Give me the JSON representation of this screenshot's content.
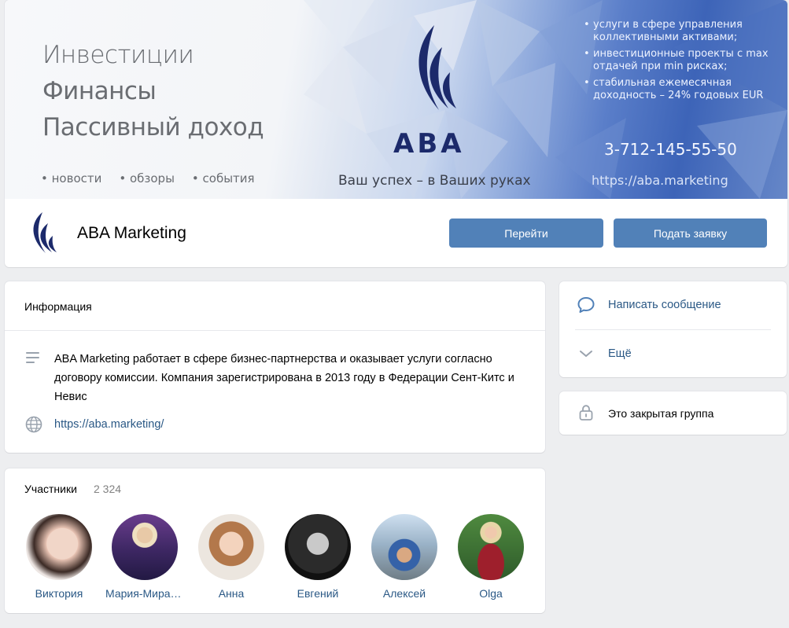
{
  "cover": {
    "line1": "Инвестиции",
    "line2": "Финансы",
    "line3": "Пассивный доход",
    "nav": [
      "• новости",
      "• обзоры",
      "• события"
    ],
    "brand": "ABA",
    "slogan": "Ваш успех – в Ваших руках",
    "bullets": [
      "услуги в сфере управления коллективными активами;",
      "инвестиционные проекты с max отдачей при min рисках;",
      "стабильная ежемесячная доходность – 24% годовых EUR"
    ],
    "phone": "3-712-145-55-50",
    "url": "https://aba.marketing"
  },
  "group": {
    "name": "ABA Marketing",
    "go_label": "Перейти",
    "apply_label": "Подать заявку"
  },
  "info": {
    "title": "Информация",
    "description": "ABA Marketing работает в сфере бизнес-партнерства и оказывает услуги согласно договору комиссии. Компания зарегистрирована в 2013 году в Федерации Сент-Китс и Невис",
    "link": "https://aba.marketing/"
  },
  "members": {
    "title": "Участники",
    "count": "2 324",
    "list": [
      {
        "name": "Виктория"
      },
      {
        "name": "Мария-Мирагуль"
      },
      {
        "name": "Анна"
      },
      {
        "name": "Евгений"
      },
      {
        "name": "Алексей"
      },
      {
        "name": "Olga"
      }
    ]
  },
  "actions": {
    "write_message": "Написать сообщение",
    "more": "Ещё",
    "closed_group": "Это закрытая группа"
  },
  "colors": {
    "accent": "#5181b8",
    "link": "#2a5885",
    "background": "#edeef0",
    "brand_navy": "#1c2a6b"
  }
}
